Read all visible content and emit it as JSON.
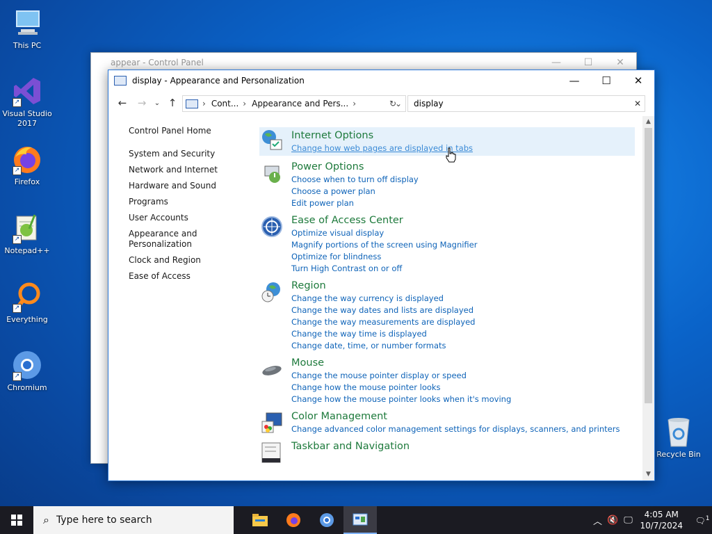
{
  "desktop": {
    "icons": [
      {
        "label": "This PC"
      },
      {
        "label": "Visual Studio 2017"
      },
      {
        "label": "Firefox"
      },
      {
        "label": "Notepad++"
      },
      {
        "label": "Everything"
      },
      {
        "label": "Chromium"
      }
    ],
    "recycle_bin": "Recycle Bin"
  },
  "back_window": {
    "title": "appear - Control Panel"
  },
  "window": {
    "title": "display - Appearance and Personalization",
    "address": {
      "crumbs": [
        "Cont...",
        "Appearance and Pers..."
      ],
      "separator": "›"
    },
    "search": {
      "value": "display"
    },
    "left_nav": {
      "home": "Control Panel Home",
      "items": [
        "System and Security",
        "Network and Internet",
        "Hardware and Sound",
        "Programs",
        "User Accounts",
        "Appearance and Personalization",
        "Clock and Region",
        "Ease of Access"
      ]
    },
    "results": [
      {
        "title": "Internet Options",
        "links": [
          "Change how web pages are displayed in tabs"
        ]
      },
      {
        "title": "Power Options",
        "links": [
          "Choose when to turn off display",
          "Choose a power plan",
          "Edit power plan"
        ]
      },
      {
        "title": "Ease of Access Center",
        "links": [
          "Optimize visual display",
          "Magnify portions of the screen using Magnifier",
          "Optimize for blindness",
          "Turn High Contrast on or off"
        ]
      },
      {
        "title": "Region",
        "links": [
          "Change the way currency is displayed",
          "Change the way dates and lists are displayed",
          "Change the way measurements are displayed",
          "Change the way time is displayed",
          "Change date, time, or number formats"
        ]
      },
      {
        "title": "Mouse",
        "links": [
          "Change the mouse pointer display or speed",
          "Change how the mouse pointer looks",
          "Change how the mouse pointer looks when it's moving"
        ]
      },
      {
        "title": "Color Management",
        "links": [
          "Change advanced color management settings for displays, scanners, and printers"
        ]
      },
      {
        "title": "Taskbar and Navigation",
        "links": []
      }
    ]
  },
  "taskbar": {
    "search_placeholder": "Type here to search",
    "time": "4:05 AM",
    "date": "10/7/2024",
    "notification_count": "1"
  },
  "colors": {
    "link": "#0e63b8",
    "heading": "#1e7a3c",
    "highlight": "#e5f1fb",
    "taskbar": "#1b1b22"
  }
}
